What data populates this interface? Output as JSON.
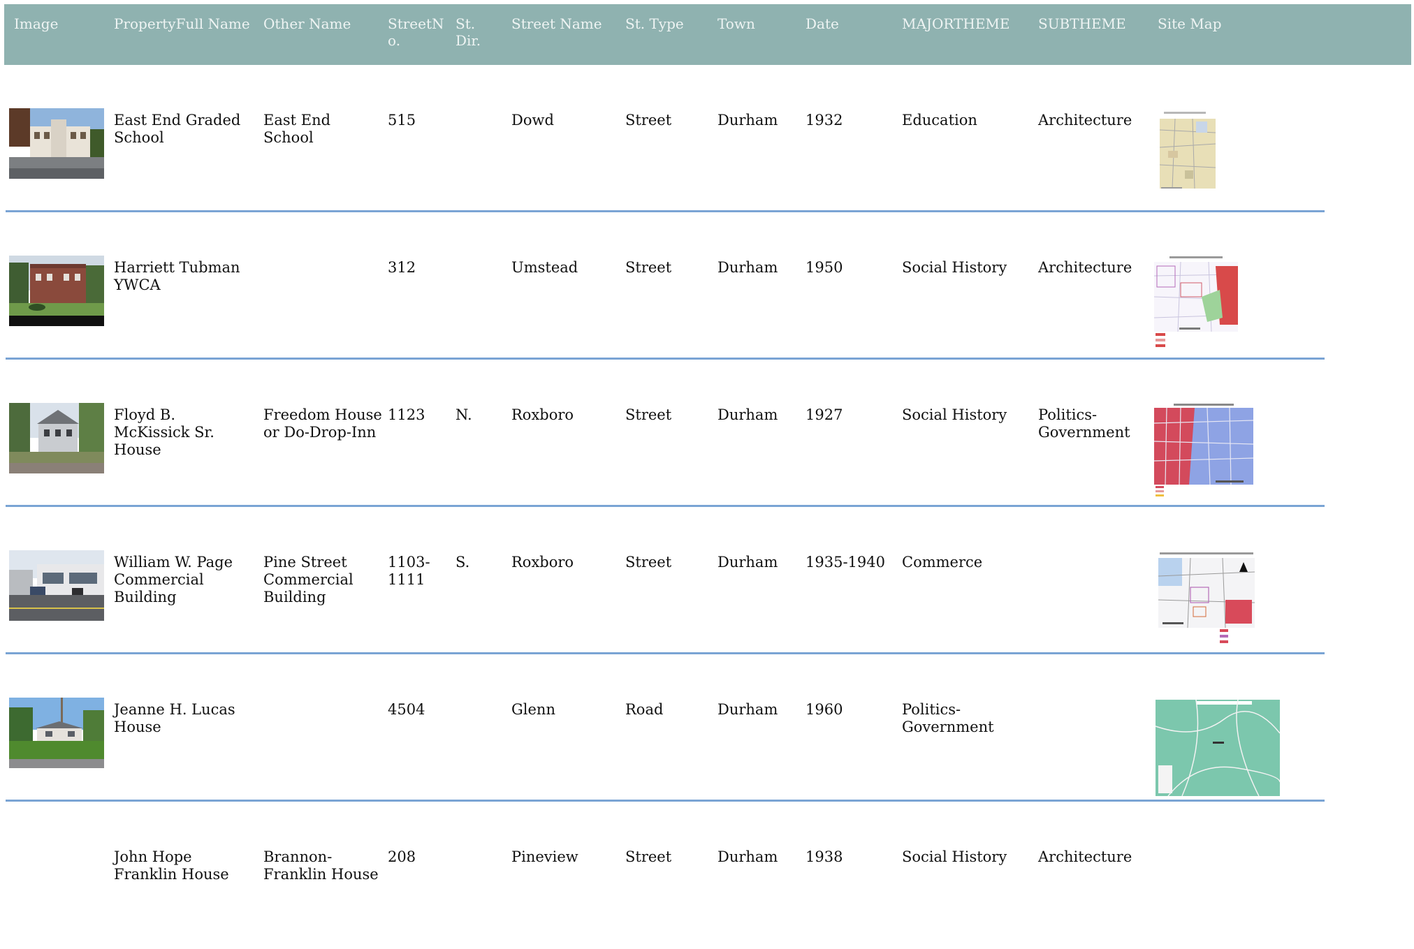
{
  "columns": [
    "Image",
    "PropertyFull Name",
    "Other Name",
    "StreetNo.",
    "St. Dir.",
    "Street Name",
    "St. Type",
    "Town",
    "Date",
    "MAJORTHEME",
    "SUBTHEME",
    "Site Map"
  ],
  "rows": [
    {
      "name": "East End Graded School",
      "other": "East End School",
      "no": "515",
      "dir": "",
      "street": "Dowd",
      "type": "Street",
      "town": "Durham",
      "date": "1932",
      "major": "Education",
      "sub": "Architecture",
      "photo": "school-photo",
      "map": "beige-map"
    },
    {
      "name": "Harriett Tubman YWCA",
      "other": "",
      "no": "312",
      "dir": "",
      "street": "Umstead",
      "type": "Street",
      "town": "Durham",
      "date": "1950",
      "major": "Social History",
      "sub": "Architecture",
      "photo": "ywca-photo",
      "map": "white-red-green-map"
    },
    {
      "name": "Floyd B. McKissick Sr. House",
      "other": "Freedom House or Do-Drop-Inn",
      "no": "1123",
      "dir": "N.",
      "street": "Roxboro",
      "type": "Street",
      "town": "Durham",
      "date": "1927",
      "major": "Social History",
      "sub": "Politics-Government",
      "photo": "house-photo",
      "map": "red-blue-map"
    },
    {
      "name": "William W. Page Commercial Building",
      "other": "Pine Street Commercial Building",
      "no": "1103-1111",
      "dir": "S.",
      "street": "Roxboro",
      "type": "Street",
      "town": "Durham",
      "date": "1935-1940",
      "major": "Commerce",
      "sub": "",
      "photo": "commercial-photo",
      "map": "mixed-map"
    },
    {
      "name": "Jeanne H. Lucas House",
      "other": "",
      "no": "4504",
      "dir": "",
      "street": "Glenn",
      "type": "Road",
      "town": "Durham",
      "date": "1960",
      "major": "Politics-Government",
      "sub": "",
      "photo": "ranch-house-photo",
      "map": "teal-map"
    },
    {
      "name": "John Hope Franklin House",
      "other": "Brannon-Franklin House",
      "no": "208",
      "dir": "",
      "street": "Pineview",
      "type": "Street",
      "town": "Durham",
      "date": "1938",
      "major": "Social History",
      "sub": "Architecture",
      "photo": "",
      "map": ""
    }
  ]
}
